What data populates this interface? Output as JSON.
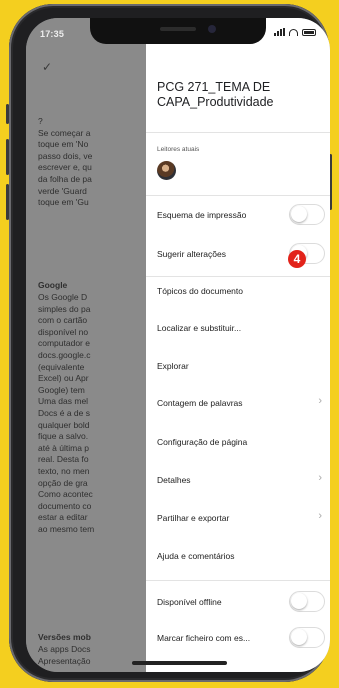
{
  "status_bar": {
    "time": "17:35"
  },
  "document": {
    "checkmark": "✓",
    "para1": "?\nSe começar a\ntoque em 'No\npasso dois, ve\nescrever e, qu\nda folha de pa\nverde 'Guard\ntoque em 'Gu",
    "heading_google": "Google",
    "para2": "Os Google D\nsimples do pa\ncom o cartão\ndisponível no\ncomputador e\ndocs.google.c\n(equivalente\nExcel) ou Apr\nGoogle) tem\nUma das mel\nDocs é a de s\nqualquer bold\nfique a salvo.\naté à última p\nreal. Desta fo\ntexto, no men\nopção de gra\nComo acontec\ndocumento co\nestar a editar\nao mesmo tem",
    "heading_versions": "Versões mob",
    "para3": "As apps Docs\nApresentação"
  },
  "panel": {
    "title": "PCG 271_TEMA DE CAPA_Produtividade",
    "viewers_label": "Leitores atuais",
    "items": [
      {
        "label": "Esquema de impressão",
        "control": "toggle"
      },
      {
        "label": "Sugerir alterações",
        "control": "toggle"
      },
      {
        "label": "Tópicos do documento"
      },
      {
        "label": "Localizar e substituir..."
      },
      {
        "label": "Explorar"
      },
      {
        "label": "Contagem de palavras",
        "control": "chevron"
      },
      {
        "label": "Configuração de página"
      },
      {
        "label": "Detalhes",
        "control": "chevron"
      },
      {
        "label": "Partilhar e exportar",
        "control": "chevron"
      },
      {
        "label": "Ajuda e comentários"
      },
      {
        "label": "Disponível offline",
        "control": "toggle"
      },
      {
        "label": "Marcar ficheiro com es...",
        "control": "toggle"
      }
    ],
    "chevron": "›",
    "step_badge": "4"
  },
  "colors": {
    "background": "#f4cf1f",
    "badge": "#e2231a",
    "panel": "#ffffff"
  }
}
